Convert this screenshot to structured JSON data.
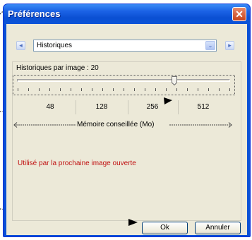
{
  "window": {
    "title": "Préférences",
    "close_glyph": "✕"
  },
  "nav": {
    "prev_glyph": "◂",
    "next_glyph": "▸",
    "combo_value": "Historiques",
    "combo_arrow": "⌄"
  },
  "history": {
    "label": "Historiques par image : 20",
    "value": 20
  },
  "memory": {
    "options": [
      "48",
      "128",
      "256",
      "512"
    ],
    "caption": "Mémoire conseillée (Mo)"
  },
  "note": "Utilisé par la prochaine image ouverte",
  "buttons": {
    "ok": "Ok",
    "cancel": "Annuler"
  },
  "colors": {
    "title_blue": "#0a50d6",
    "note_red": "#c01010",
    "dialog_bg": "#ece9d8"
  }
}
